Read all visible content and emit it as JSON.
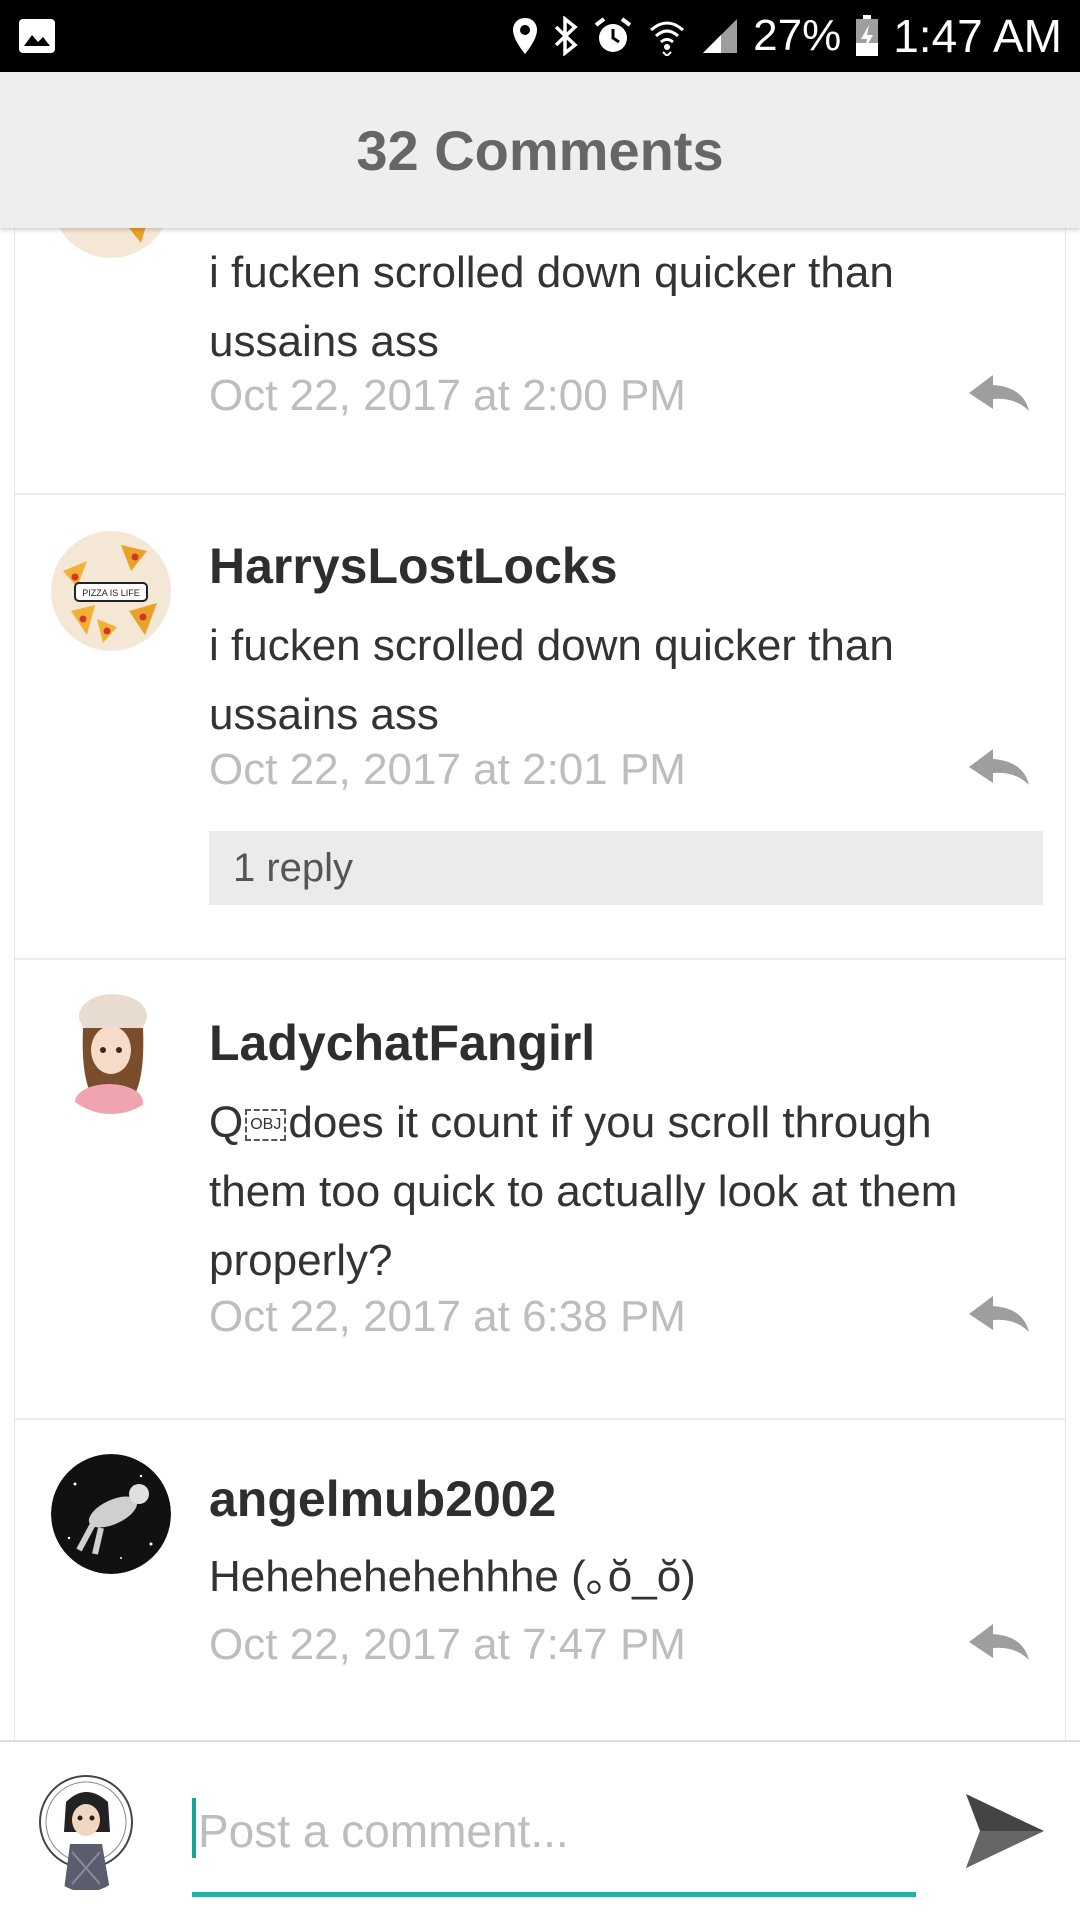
{
  "status_bar": {
    "battery": "27%",
    "time": "1:47 AM",
    "icons": [
      "image-icon",
      "location-icon",
      "bluetooth-icon",
      "alarm-icon",
      "wifi-icon",
      "signal-icon",
      "battery-icon"
    ]
  },
  "header": {
    "title": "32 Comments"
  },
  "comments": [
    {
      "username": "",
      "text": "i fucken scrolled down quicker than ussains ass",
      "timestamp": "Oct 22, 2017 at 2:00 PM"
    },
    {
      "username": "HarrysLostLocks",
      "avatar_label": "PIZZA IS LIFE",
      "text": "i fucken scrolled down quicker than ussains ass",
      "timestamp": "Oct 22, 2017 at 2:01 PM",
      "reply_label": "1 reply"
    },
    {
      "username": "LadychatFangirl",
      "text_prefix": "Q",
      "obj_label": "OBJ",
      "text": "does it  count if you scroll through them too quick to actually look at them properly?",
      "timestamp": "Oct 22, 2017 at 6:38 PM"
    },
    {
      "username": "angelmub2002",
      "text": "Hehehehehehhhe (｡ŏ_ŏ)",
      "timestamp": "Oct 22, 2017 at 7:47 PM"
    }
  ],
  "composer": {
    "placeholder": "Post a comment..."
  },
  "colors": {
    "accent": "#26b0a4",
    "header_bg": "#eeeeee",
    "timestamp": "#bdbdbd"
  }
}
